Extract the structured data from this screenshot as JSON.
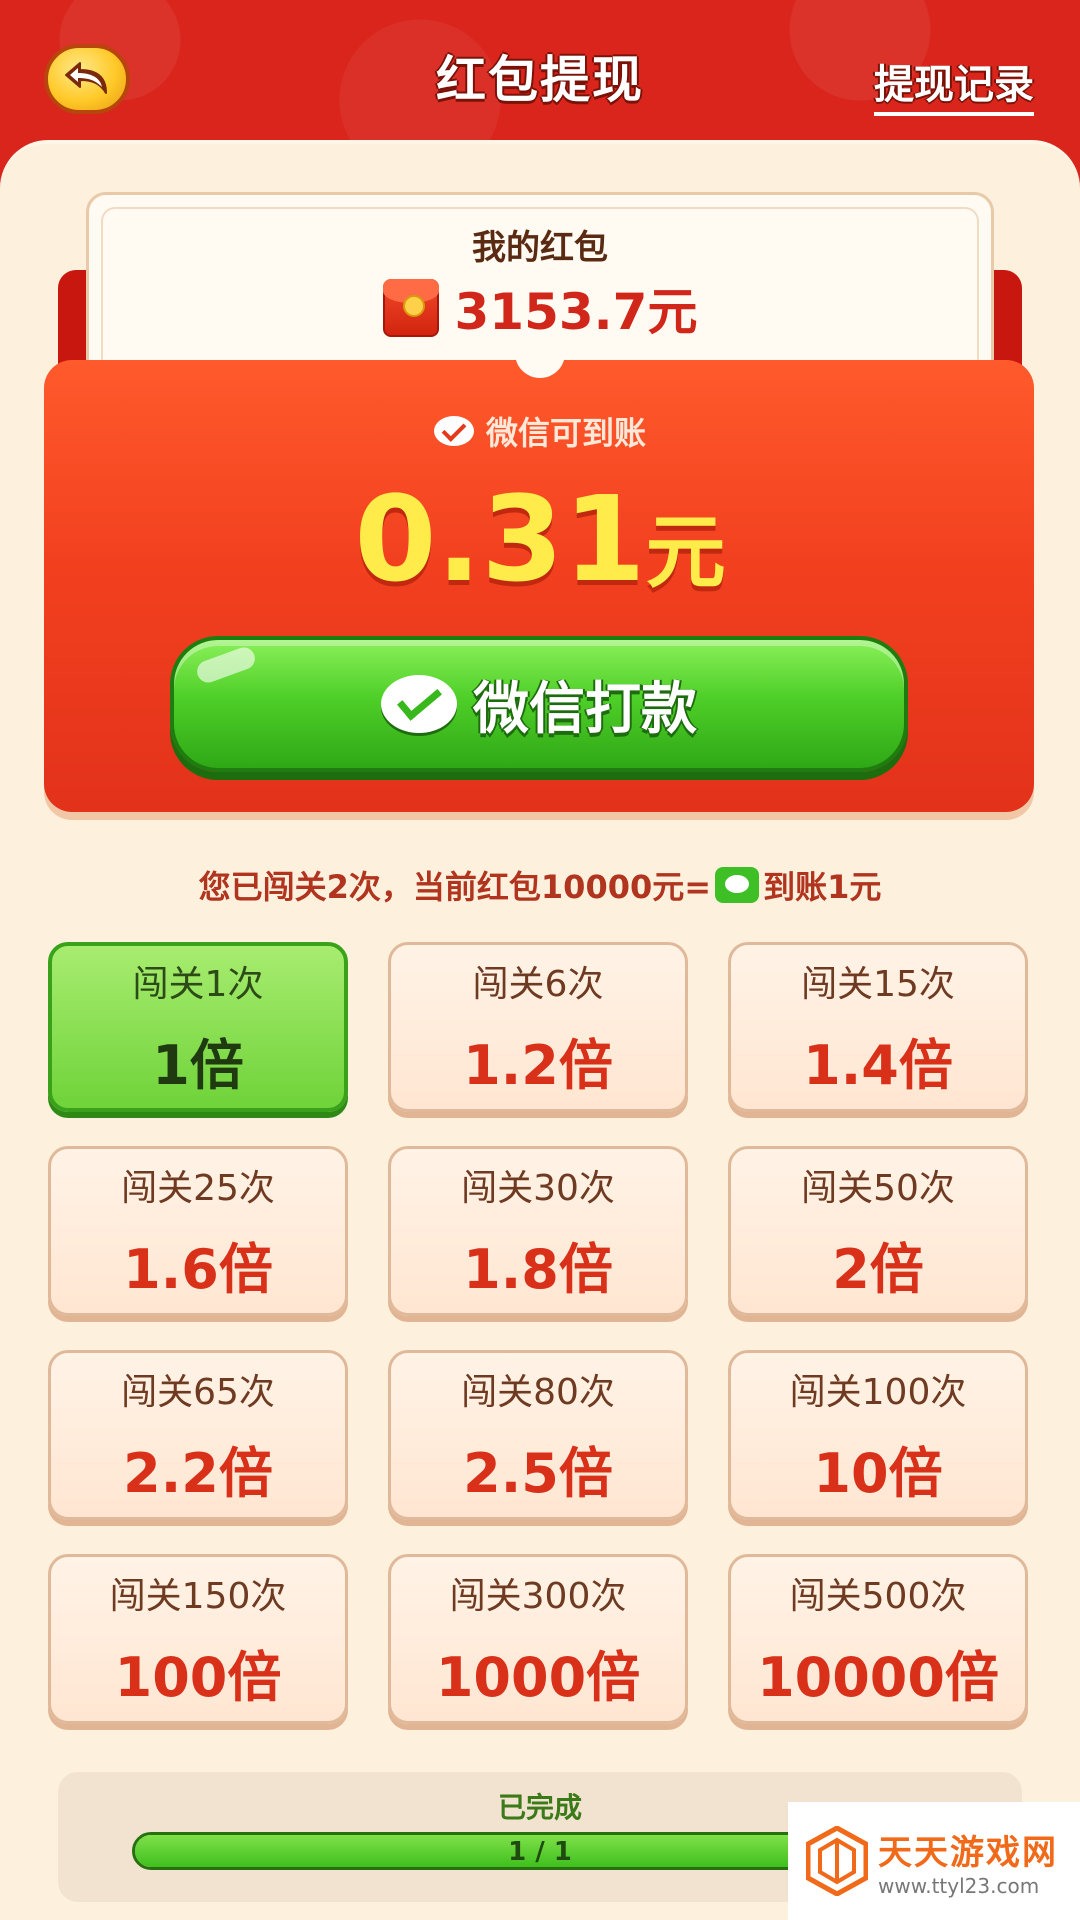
{
  "header": {
    "title": "红包提现",
    "history_link": "提现记录",
    "back_icon": "back-arrow-icon"
  },
  "balance": {
    "label": "我的红包",
    "amount": "3153.7元"
  },
  "withdraw": {
    "subtitle": "微信可到账",
    "amount": "0.31",
    "unit": "元",
    "button_label": "微信打款"
  },
  "notice": {
    "text_before": "您已闯关2次，当前红包10000元=",
    "text_after": "到账1元"
  },
  "tiers": [
    {
      "cond": "闯关1次",
      "mult": "1倍",
      "active": true
    },
    {
      "cond": "闯关6次",
      "mult": "1.2倍",
      "active": false
    },
    {
      "cond": "闯关15次",
      "mult": "1.4倍",
      "active": false
    },
    {
      "cond": "闯关25次",
      "mult": "1.6倍",
      "active": false
    },
    {
      "cond": "闯关30次",
      "mult": "1.8倍",
      "active": false
    },
    {
      "cond": "闯关50次",
      "mult": "2倍",
      "active": false
    },
    {
      "cond": "闯关65次",
      "mult": "2.2倍",
      "active": false
    },
    {
      "cond": "闯关80次",
      "mult": "2.5倍",
      "active": false
    },
    {
      "cond": "闯关100次",
      "mult": "10倍",
      "active": false
    },
    {
      "cond": "闯关150次",
      "mult": "100倍",
      "active": false
    },
    {
      "cond": "闯关300次",
      "mult": "1000倍",
      "active": false
    },
    {
      "cond": "闯关500次",
      "mult": "10000倍",
      "active": false
    }
  ],
  "progress": {
    "label": "已完成",
    "text": "1 / 1",
    "fraction": 1.0
  },
  "watermark": {
    "title": "天天游戏网",
    "url": "www.ttyl23.com"
  },
  "colors": {
    "header_red": "#d9251c",
    "panel_cream": "#fdf0dd",
    "accent_green": "#4fcf28",
    "amount_yellow": "#ffec4a"
  }
}
